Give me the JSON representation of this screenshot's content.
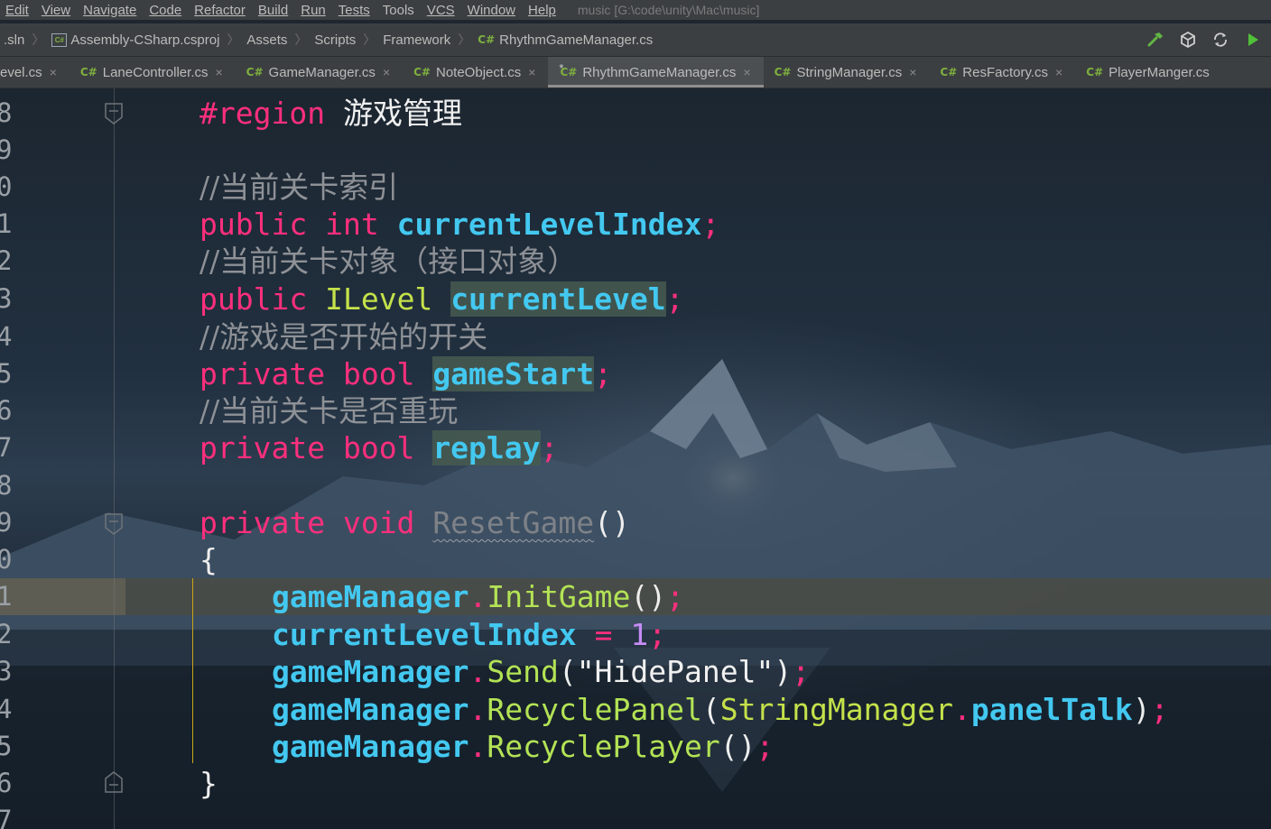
{
  "menu": {
    "items": [
      "Edit",
      "View",
      "Navigate",
      "Code",
      "Refactor",
      "Build",
      "Run",
      "Tests",
      "Tools",
      "VCS",
      "Window",
      "Help"
    ],
    "title": "music [G:\\code\\unity\\Mac\\music]"
  },
  "breadcrumb": {
    "sln": ".sln",
    "project": "Assembly-CSharp.csproj",
    "assets": "Assets",
    "scripts": "Scripts",
    "framework": "Framework",
    "file": "RhythmGameManager.cs"
  },
  "tabs": [
    {
      "label": "evel.cs",
      "icon": false
    },
    {
      "label": "LaneController.cs",
      "icon": true
    },
    {
      "label": "GameManager.cs",
      "icon": true
    },
    {
      "label": "NoteObject.cs",
      "icon": true
    },
    {
      "label": "RhythmGameManager.cs",
      "icon": true,
      "active": true,
      "modified": "*"
    },
    {
      "label": "StringManager.cs",
      "icon": true
    },
    {
      "label": "ResFactory.cs",
      "icon": true
    },
    {
      "label": "PlayerManger.cs",
      "icon": true
    }
  ],
  "icons": {
    "csharp": "C#",
    "close": "×",
    "separator": "〉"
  },
  "editor": {
    "line_numbers": [
      "8",
      "9",
      "0",
      "1",
      "2",
      "3",
      "4",
      "5",
      "6",
      "7",
      "8",
      "9",
      "0",
      "1",
      "2",
      "3",
      "4",
      "5",
      "6",
      "7"
    ],
    "code": {
      "region_kw": "#region",
      "region_name": "游戏管理",
      "c1": "//当前关卡索引",
      "public": "public",
      "int": "int",
      "currentLevelIndex": "currentLevelIndex",
      "semi": ";",
      "c2": "//当前关卡对象（接口对象）",
      "ILevel": "ILevel",
      "currentLevel": "currentLevel",
      "c3": "//游戏是否开始的开关",
      "private": "private",
      "bool": "bool",
      "gameStart": "gameStart",
      "c4": "//当前关卡是否重玩",
      "replay": "replay",
      "void": "void",
      "ResetGame": "ResetGame",
      "parens": "()",
      "open_brace": "{",
      "close_brace": "}",
      "gameManager": "gameManager",
      "dot": ".",
      "InitGame": "InitGame",
      "assign": " = ",
      "one": "1",
      "Send": "Send",
      "lparen": "(",
      "rparen": ")",
      "hidePanel": "\"HidePanel\"",
      "RecyclePanel": "RecyclePanel",
      "StringManager": "StringManager",
      "panelTalk": "panelTalk",
      "RecyclePlayer": "RecyclePlayer"
    }
  },
  "colors": {
    "keyword": "#ff2f7d",
    "type": "#c4e14a",
    "field": "#43c8f0",
    "method": "#b3e355",
    "comment": "#8e9196",
    "number": "#c58cf5",
    "indent_guide": "#c8a418"
  }
}
